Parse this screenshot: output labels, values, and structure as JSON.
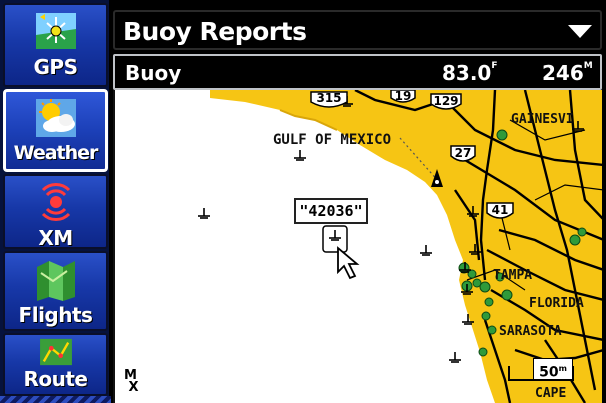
{
  "sidebar": {
    "items": [
      {
        "label": "GPS",
        "icon": "gps-icon"
      },
      {
        "label": "Weather",
        "icon": "weather-icon"
      },
      {
        "label": "XM",
        "icon": "xm-icon"
      },
      {
        "label": "Flights",
        "icon": "flights-icon"
      },
      {
        "label": "Route",
        "icon": "route-icon"
      }
    ],
    "active": "Weather"
  },
  "header": {
    "title": "Buoy Reports",
    "dropdown_icon": "triangle-down-icon"
  },
  "info_bar": {
    "name": "Buoy",
    "temperature": "83.0",
    "temperature_unit": "F",
    "direction": "246",
    "direction_unit": "M"
  },
  "map": {
    "region_label": "GULF OF MEXICO",
    "selected_buoy": "\"42036\"",
    "cities": [
      "GAINESVI",
      "TAMPA",
      "FLORIDA",
      "SARASOTA",
      "CAPE"
    ],
    "highway_shields": [
      "19",
      "129",
      "27",
      "41",
      "315",
      "75"
    ],
    "scale": "50",
    "scale_unit": "m",
    "mx_icon": "MX",
    "colors": {
      "land": "#f6c514",
      "water": "#ffffff",
      "roads": "#000000",
      "city_dots": "#2f9a3a"
    }
  }
}
